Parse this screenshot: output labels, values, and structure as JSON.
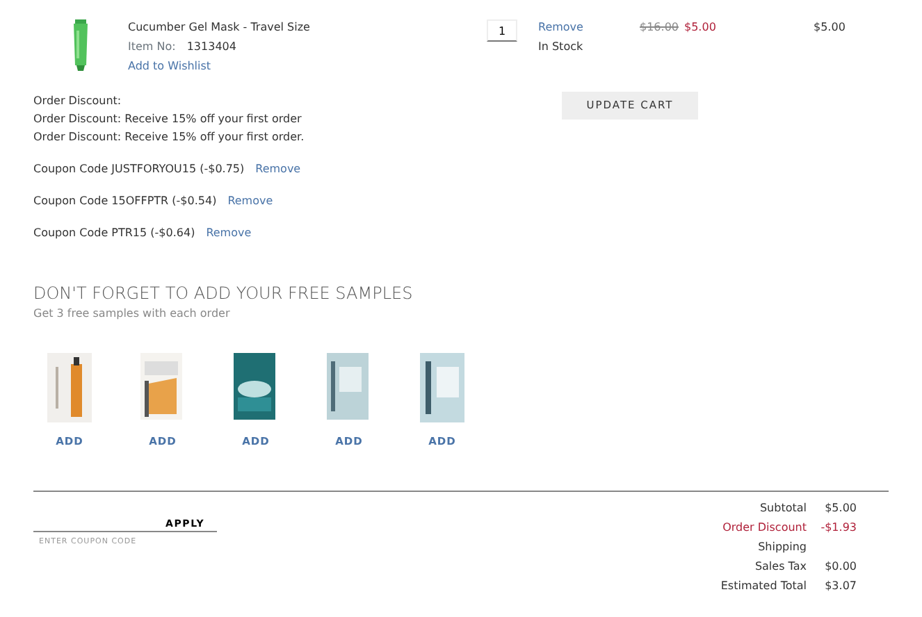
{
  "cart_item": {
    "name": "Cucumber Gel Mask - Travel Size",
    "item_no_label": "Item No:",
    "item_no": "1313404",
    "wishlist_link": "Add to Wishlist",
    "quantity": "1",
    "remove_link": "Remove",
    "stock": "In Stock",
    "old_price": "$16.00",
    "price": "$5.00",
    "total": "$5.00"
  },
  "update_button": "UPDATE CART",
  "discounts": [
    "Order Discount:",
    "Order Discount: Receive 15% off your first order",
    "Order Discount: Receive 15% off your first order."
  ],
  "coupons": [
    {
      "text": "Coupon Code JUSTFORYOU15 (-$0.75)",
      "remove": "Remove"
    },
    {
      "text": "Coupon Code 15OFFPTR (-$0.54)",
      "remove": "Remove"
    },
    {
      "text": "Coupon Code PTR15 (-$0.64)",
      "remove": "Remove"
    }
  ],
  "samples": {
    "title": "DON'T FORGET TO ADD YOUR FREE SAMPLES",
    "subtitle": "Get 3 free samples with each order",
    "items": [
      {
        "kind": "picture",
        "add": "ADD"
      },
      {
        "kind": "picture",
        "add": "ADD"
      },
      {
        "kind": "picture",
        "add": "ADD"
      },
      {
        "kind": "picture",
        "add": "ADD"
      },
      {
        "kind": "picture",
        "add": "ADD"
      }
    ]
  },
  "coupon_form": {
    "placeholder": "ENTER COUPON CODE",
    "apply": "APPLY"
  },
  "totals": [
    {
      "label": "Subtotal",
      "value": "$5.00",
      "kind": "normal"
    },
    {
      "label": "Order Discount",
      "value": "-$1.93",
      "kind": "discount"
    },
    {
      "label": "Shipping",
      "kind": "normal"
    },
    {
      "label": "Sales Tax",
      "value": "$0.00",
      "kind": "normal"
    },
    {
      "label": "Estimated Total",
      "value": "$3.07",
      "kind": "normal"
    }
  ]
}
